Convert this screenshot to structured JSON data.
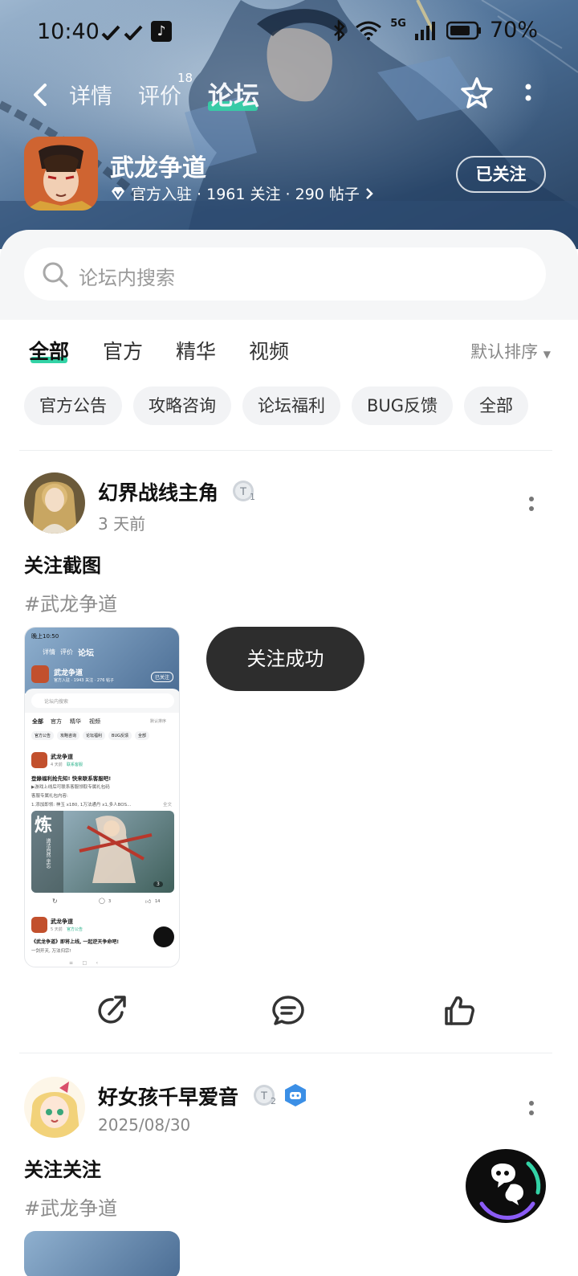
{
  "status_bar": {
    "time": "10:40",
    "network": "5G",
    "battery": "70%"
  },
  "nav": {
    "tabs": [
      {
        "label": "详情"
      },
      {
        "label": "评价",
        "badge": "18"
      },
      {
        "label": "论坛",
        "active": true
      }
    ],
    "back_icon": "chevron-left-icon",
    "favorite_icon": "star-icon",
    "more_icon": "more-vertical-icon"
  },
  "app": {
    "name": "武龙争道",
    "meta": "官方入驻 · 1961 关注 · 290 帖子",
    "follow_label": "已关注"
  },
  "search": {
    "placeholder": "论坛内搜索"
  },
  "filter_tabs": [
    {
      "label": "全部",
      "active": true
    },
    {
      "label": "官方"
    },
    {
      "label": "精华"
    },
    {
      "label": "视频"
    }
  ],
  "sort_label": "默认排序",
  "chips": [
    "官方公告",
    "攻略咨询",
    "论坛福利",
    "BUG反馈",
    "全部"
  ],
  "posts": [
    {
      "author": "幻界战线主角",
      "level": "1",
      "time": "3 天前",
      "title": "关注截图",
      "tag": "#武龙争道"
    },
    {
      "author": "好女孩千早爱音",
      "level": "2",
      "time": "2025/08/30",
      "title": "关注关注",
      "tag": "#武龙争道"
    }
  ],
  "toast": "关注成功",
  "post_actions": [
    "share-icon",
    "comment-icon",
    "like-icon"
  ],
  "colors": {
    "accent": "#33d3a6",
    "hero_bg": "#3f628a",
    "toast_bg": "#2d2d2d"
  },
  "screenshot_thumbnail": {
    "time": "晚上10:50",
    "tabs": [
      "详情",
      "评价",
      "论坛"
    ],
    "app_name": "武龙争道",
    "app_meta": "官方入驻 · 1943 关注 · 276 帖子",
    "follow": "已关注",
    "search": "论坛内搜索",
    "filter_tabs": [
      "全部",
      "官方",
      "精华",
      "视频"
    ],
    "sort": "默认排序",
    "chips": [
      "官方公告",
      "攻略咨询",
      "论坛福利",
      "BUG反馈",
      "全部"
    ],
    "post1_author": "武龙争道",
    "post1_meta": "4 天前",
    "post1_badge": "联系客服",
    "post1_title": "登錄福利抢先知! 快来联系客服吧!",
    "post1_line1": "▶游戏上线后可联系客服领取专属礼包码",
    "post1_line2": "客服专属礼包内容:",
    "post1_line3": "1.添加即领: 神玉 x180, 1万法通丹 x1,多人BOS...",
    "post1_more": "全文",
    "post1_image_text": "炼",
    "post1_image_side": "道法自然 坐忘",
    "post1_image_count": "3",
    "post1_comments": "3",
    "post1_likes": "14",
    "post2_author": "武龙争道",
    "post2_meta": "5 天前",
    "post2_badge": "官方公告",
    "post2_title": "《武龙争道》即将上线, 一起逆天争命吧!",
    "post2_line": "一剑开天, 万法归宗!"
  }
}
